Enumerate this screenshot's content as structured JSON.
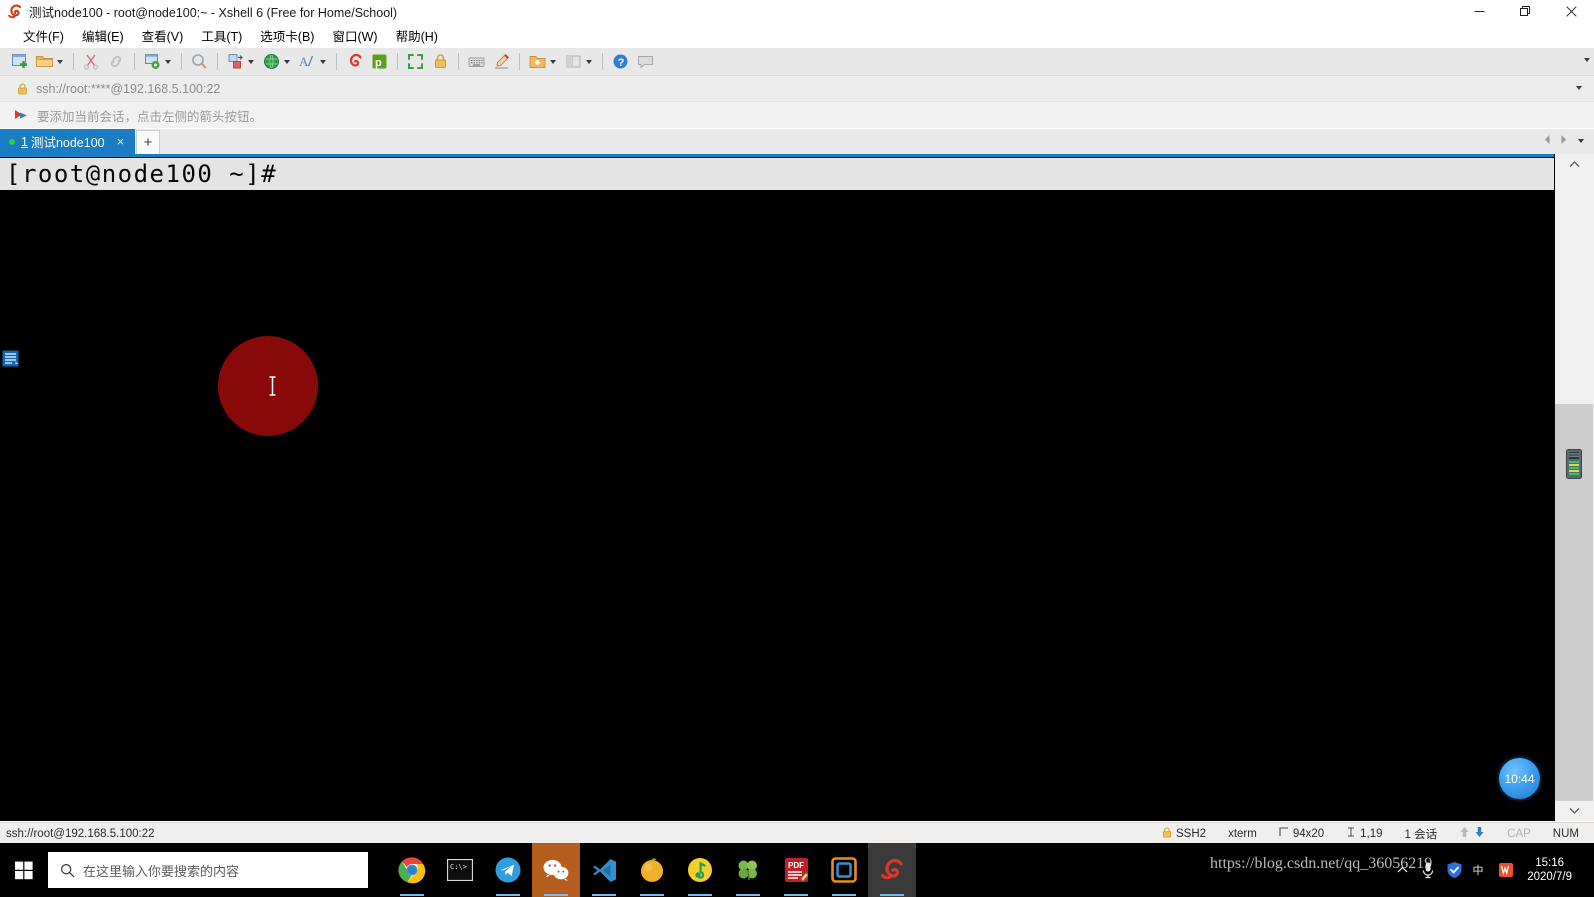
{
  "window": {
    "title": "测试node100 - root@node100:~ - Xshell 6 (Free for Home/School)",
    "app_icon": "xshell-icon",
    "controls": {
      "minimize": "minimize-icon",
      "restore": "restore-icon",
      "close": "close-icon"
    }
  },
  "menubar": {
    "items": [
      {
        "label": "文件(F)",
        "name": "menu-file"
      },
      {
        "label": "编辑(E)",
        "name": "menu-edit"
      },
      {
        "label": "查看(V)",
        "name": "menu-view"
      },
      {
        "label": "工具(T)",
        "name": "menu-tools"
      },
      {
        "label": "选项卡(B)",
        "name": "menu-tabs"
      },
      {
        "label": "窗口(W)",
        "name": "menu-window"
      },
      {
        "label": "帮助(H)",
        "name": "menu-help"
      }
    ]
  },
  "toolbar": {
    "icons": [
      "new-session-icon",
      "open-folder-icon",
      "cut-icon",
      "link-icon",
      "session-properties-icon",
      "search-icon",
      "transfer-icon",
      "globe-icon",
      "font-icon",
      "xftp-icon",
      "xagent-icon",
      "fullscreen-icon",
      "lock-icon",
      "keyboard-icon",
      "highlight-icon",
      "folder-add-icon",
      "layout-icon",
      "help-icon",
      "comment-icon"
    ],
    "overflow": "chevron-down-icon"
  },
  "address_bar": {
    "lock": "lock-icon",
    "url": "ssh://root:****@192.168.5.100:22",
    "dropdown": "chevron-down-icon"
  },
  "notice_bar": {
    "icon": "arrow-flag-icon",
    "text": "要添加当前会话，点击左侧的箭头按钮。"
  },
  "tabbar": {
    "tabs": [
      {
        "index": "1",
        "title": "测试node100",
        "status_dot": "connected",
        "close": "close-icon",
        "name": "tab-node100"
      }
    ],
    "new_tab": "+",
    "nav_prev": "chevron-left-icon",
    "nav_next": "chevron-right-icon",
    "tab_list": "chevron-down-icon"
  },
  "terminal": {
    "prompt": "[root@node100 ~]#",
    "doc_icon": "document-icon",
    "cursor": "ibeam-cursor",
    "click_highlight": "click-halo",
    "accent_color": "#1a7dc4",
    "background": "#000000"
  },
  "floating_badge": {
    "time": "10:44",
    "name": "floating-clock-badge"
  },
  "scrollbar": {
    "up": "chevron-up-icon",
    "down": "chevron-down-icon",
    "gadget": "gadget-icon"
  },
  "statusbar": {
    "connection": "ssh://root@192.168.5.100:22",
    "protocol": "SSH2",
    "terminal_type": "xterm",
    "size": "94x20",
    "cursor_pos": "1,19",
    "sessions": "1 会话",
    "cap": "CAP",
    "num": "NUM",
    "lock_icon": "lock-icon",
    "size_icon": "resize-icon",
    "pos_icon": "cursor-icon",
    "up_icon": "upload-arrow-icon",
    "down_icon": "download-arrow-icon"
  },
  "taskbar": {
    "start": "windows-start-icon",
    "search": {
      "icon": "search-icon",
      "placeholder": "在这里输入你要搜索的内容"
    },
    "apps": [
      {
        "name": "taskbar-chrome",
        "icon": "chrome-icon",
        "running": true
      },
      {
        "name": "taskbar-terminal",
        "icon": "terminal-icon",
        "running": false
      },
      {
        "name": "taskbar-telegram",
        "icon": "telegram-icon",
        "running": true
      },
      {
        "name": "taskbar-wechat",
        "icon": "wechat-icon",
        "running": true,
        "active": true
      },
      {
        "name": "taskbar-vscode",
        "icon": "vscode-icon",
        "running": true
      },
      {
        "name": "taskbar-orange",
        "icon": "orange-ball-icon",
        "running": true
      },
      {
        "name": "taskbar-qqmusic",
        "icon": "qqmusic-icon",
        "running": true
      },
      {
        "name": "taskbar-clover",
        "icon": "clover-icon",
        "running": true
      },
      {
        "name": "taskbar-pdf",
        "icon": "pdf-icon",
        "running": true
      },
      {
        "name": "taskbar-vmware",
        "icon": "vmware-icon",
        "running": true
      },
      {
        "name": "taskbar-xshell",
        "icon": "xshell-icon",
        "running": true
      }
    ],
    "tray": {
      "overflow": "chevron-up-icon",
      "icons": [
        "microphone-icon",
        "security-shield-icon",
        "input-method-icon",
        "wps-icon"
      ],
      "time": "15:16",
      "date": "2020/7/9"
    }
  },
  "watermark": {
    "text": "https://blog.csdn.net/qq_36056219"
  }
}
